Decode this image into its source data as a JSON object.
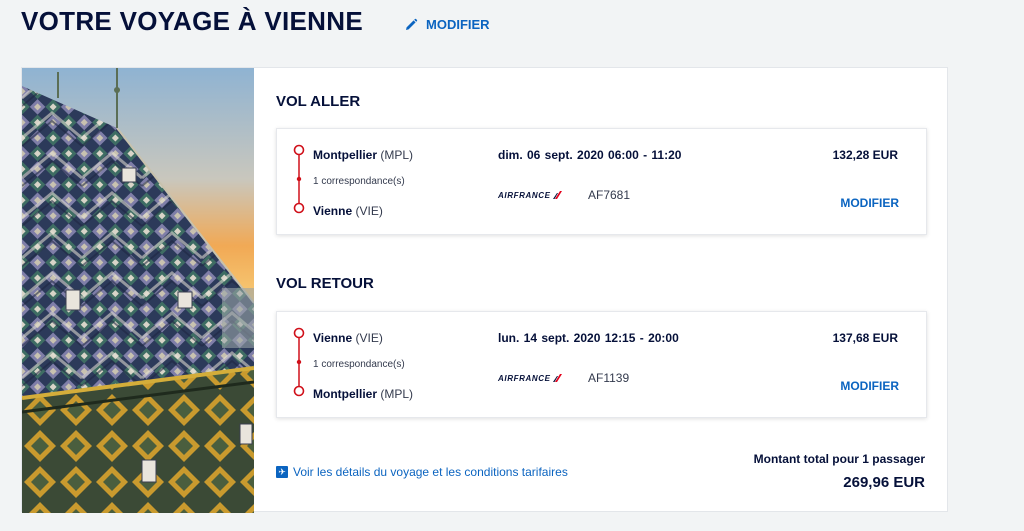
{
  "header": {
    "title": "VOTRE VOYAGE À VIENNE",
    "edit_label": "MODIFIER",
    "edit_icon": "pencil-icon"
  },
  "outbound": {
    "section_title": "VOL ALLER",
    "origin_city": "Montpellier",
    "origin_code": "(MPL)",
    "connections": "1 correspondance(s)",
    "destination_city": "Vienne",
    "destination_code": "(VIE)",
    "datetime": "dim. 06 sept. 2020  06:00 - 11:20",
    "airline": "AIRFRANCE",
    "flight_number": "AF7681",
    "price": "132,28 EUR",
    "modify_label": "MODIFIER"
  },
  "return": {
    "section_title": "VOL RETOUR",
    "origin_city": "Vienne",
    "origin_code": "(VIE)",
    "connections": "1 correspondance(s)",
    "destination_city": "Montpellier",
    "destination_code": "(MPL)",
    "datetime": "lun. 14 sept. 2020  12:15 - 20:00",
    "airline": "AIRFRANCE",
    "flight_number": "AF1139",
    "price": "137,68 EUR",
    "modify_label": "MODIFIER"
  },
  "footer": {
    "details_link": "Voir les détails du voyage et les conditions tarifaires",
    "details_icon": "plane-doc-icon",
    "total_label": "Montant total pour 1 passager",
    "total_amount": "269,96 EUR"
  },
  "colors": {
    "navy": "#051039",
    "link_blue": "#0b64c0",
    "route_red": "#d0101a",
    "af_red": "#e3001b"
  }
}
